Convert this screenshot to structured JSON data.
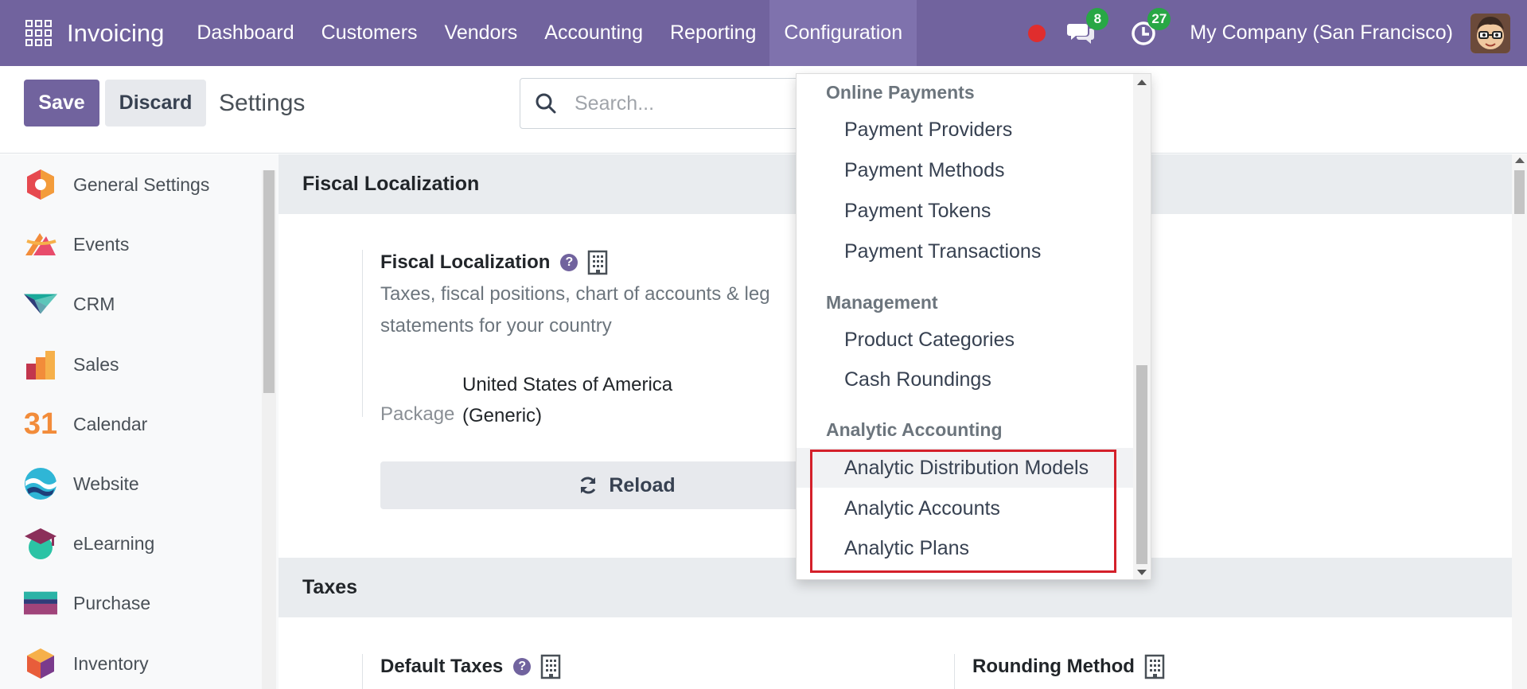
{
  "navbar": {
    "brand": "Invoicing",
    "items": [
      {
        "label": "Dashboard"
      },
      {
        "label": "Customers"
      },
      {
        "label": "Vendors"
      },
      {
        "label": "Accounting"
      },
      {
        "label": "Reporting"
      },
      {
        "label": "Configuration"
      }
    ],
    "messages_badge": "8",
    "activities_badge": "27",
    "company": "My Company (San Francisco)",
    "colors": {
      "primary": "#71639e",
      "active": "#7f72ad",
      "badge": "#28a745",
      "recording": "#e02d2d"
    }
  },
  "control": {
    "save_label": "Save",
    "discard_label": "Discard",
    "title": "Settings",
    "search_placeholder": "Search..."
  },
  "sidebar": {
    "items": [
      {
        "label": "General Settings",
        "icon": "general-settings-icon"
      },
      {
        "label": "Events",
        "icon": "events-icon"
      },
      {
        "label": "CRM",
        "icon": "crm-icon"
      },
      {
        "label": "Sales",
        "icon": "sales-icon"
      },
      {
        "label": "Calendar",
        "icon": "calendar-icon",
        "glyph": "31"
      },
      {
        "label": "Website",
        "icon": "website-icon"
      },
      {
        "label": "eLearning",
        "icon": "elearning-icon"
      },
      {
        "label": "Purchase",
        "icon": "purchase-icon"
      },
      {
        "label": "Inventory",
        "icon": "inventory-icon"
      }
    ]
  },
  "main": {
    "fiscal_section": "Fiscal Localization",
    "fiscal_title": "Fiscal Localization",
    "help_glyph": "?",
    "fiscal_desc_line1": "Taxes, fiscal positions, chart of accounts & leg",
    "fiscal_desc_line2": "statements for your country",
    "package_label": "Package",
    "package_value_line1": "United States of America",
    "package_value_line2": "(Generic)",
    "reload_label": "Reload",
    "taxes_section": "Taxes",
    "default_taxes": "Default Taxes",
    "rounding_method": "Rounding Method"
  },
  "dropdown": {
    "groups": [
      {
        "header": "Online Payments",
        "items": [
          "Payment Providers",
          "Payment Methods",
          "Payment Tokens",
          "Payment Transactions"
        ]
      },
      {
        "header": "Management",
        "items": [
          "Product Categories",
          "Cash Roundings"
        ]
      },
      {
        "header": "Analytic Accounting",
        "items": [
          "Analytic Distribution Models",
          "Analytic Accounts",
          "Analytic Plans"
        ]
      }
    ],
    "highlight_color": "#d4202a"
  }
}
